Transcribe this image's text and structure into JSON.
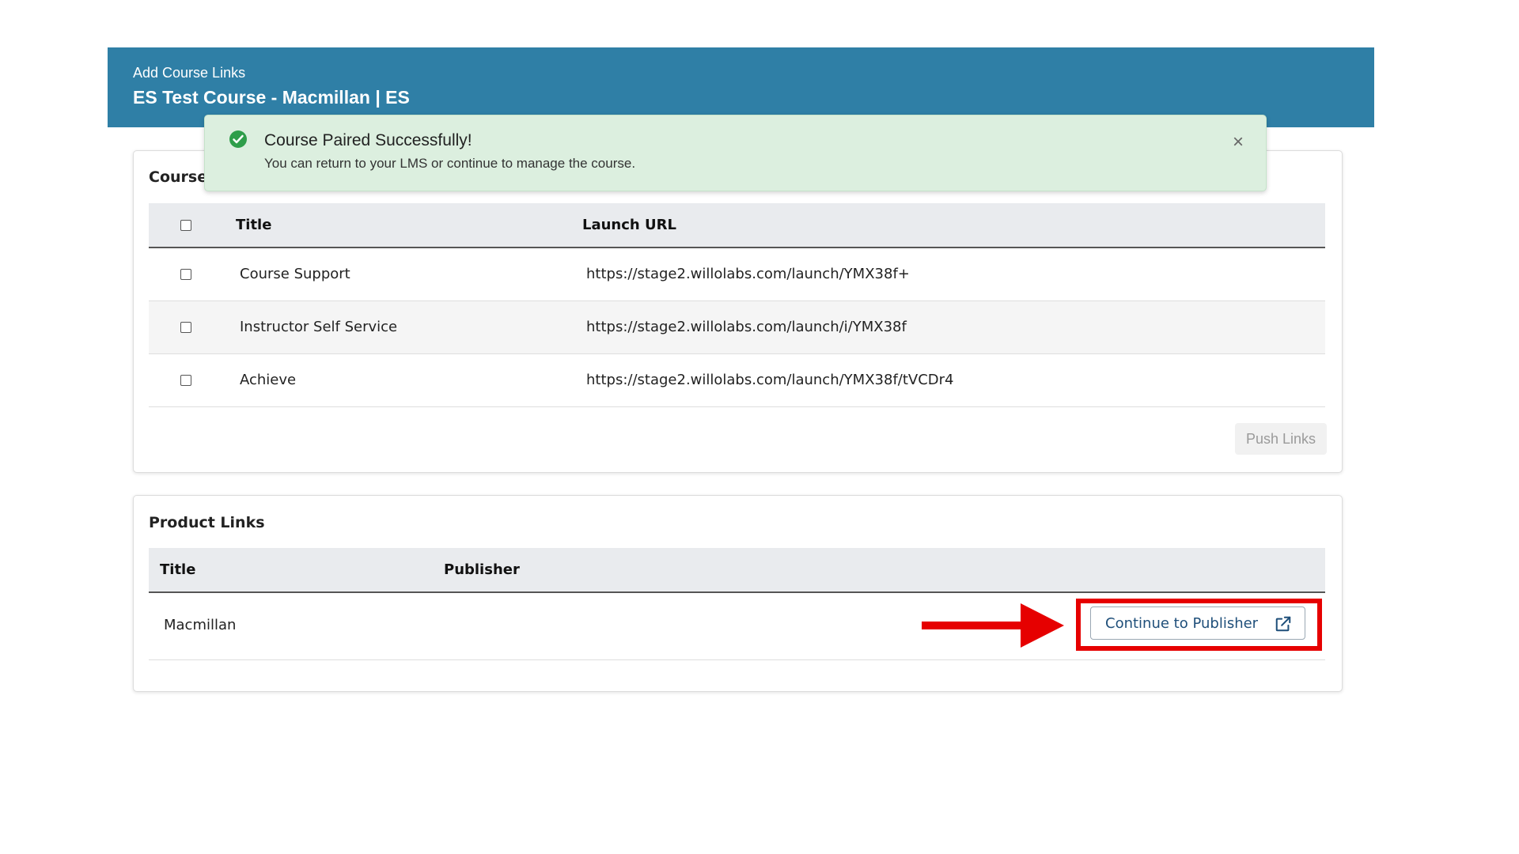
{
  "header": {
    "subtitle": "Add Course Links",
    "title": "ES Test Course - Macmillan | ES",
    "background_color": "#2f7fa6"
  },
  "toast": {
    "icon": "check-circle-icon",
    "title": "Course Paired Successfully!",
    "message": "You can return to your LMS or continue to manage the course.",
    "close_label": "×",
    "background_color": "#dcefdf"
  },
  "course_links": {
    "label": "Course",
    "columns": [
      "Title",
      "Launch URL"
    ],
    "rows": [
      {
        "title": "Course Support",
        "url": "https://stage2.willolabs.com/launch/YMX38f+"
      },
      {
        "title": "Instructor Self Service",
        "url": "https://stage2.willolabs.com/launch/i/YMX38f"
      },
      {
        "title": "Achieve",
        "url": "https://stage2.willolabs.com/launch/YMX38f/tVCDr4"
      }
    ],
    "push_button": "Push Links"
  },
  "product_links": {
    "label": "Product Links",
    "columns": [
      "Title",
      "Publisher"
    ],
    "rows": [
      {
        "title": "Macmillan",
        "publisher": "",
        "action": "Continue to Publisher",
        "action_icon": "external-link-icon"
      }
    ]
  },
  "annotation": {
    "highlight_color": "#e60000"
  }
}
